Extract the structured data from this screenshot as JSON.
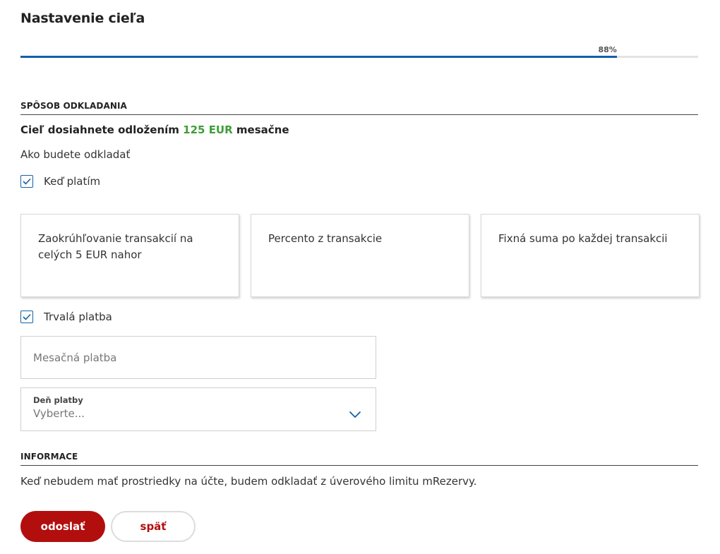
{
  "page": {
    "title": "Nastavenie cieľa"
  },
  "progress": {
    "label": "88%",
    "value_percent": 88,
    "color": "#1460a8"
  },
  "saving": {
    "section_title": "SPÔSOB ODKLADANIA",
    "goal_prefix": "Cieľ dosiahnete odložením",
    "goal_amount": "125 EUR",
    "goal_suffix": "mesačne",
    "amount_color": "#3d9e37",
    "how_label": "Ako budete odkladať",
    "when_paying": {
      "label": "Keď platím",
      "checked": true,
      "icon": "check-icon"
    },
    "options": [
      {
        "label": "Zaokrúhľovanie transakcií na celých 5 EUR nahor"
      },
      {
        "label": "Percento z transakcie"
      },
      {
        "label": "Fixná suma po každej transakcii"
      }
    ],
    "standing_order": {
      "label": "Trvalá platba",
      "checked": true,
      "icon": "check-icon"
    },
    "monthly_payment": {
      "placeholder": "Mesačná platba",
      "value": ""
    },
    "payment_day": {
      "label": "Deň platby",
      "value": "Vyberte...",
      "icon": "chevron-down-icon"
    }
  },
  "info": {
    "section_title": "INFORMACE",
    "text": "Keď nebudem mať prostriedky na účte, budem odkladať z úverového limitu mRezervy."
  },
  "actions": {
    "submit_label": "odoslať",
    "back_label": "späť",
    "primary_color": "#b30e0e"
  }
}
